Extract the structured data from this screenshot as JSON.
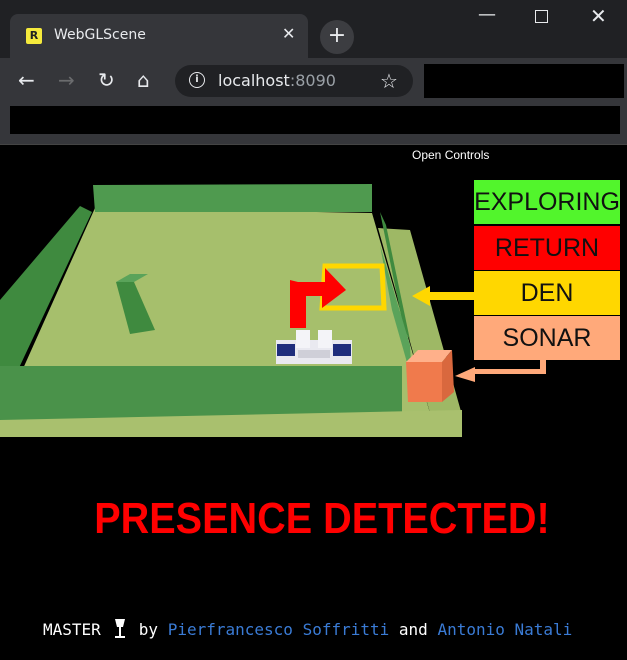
{
  "browser": {
    "tab_title": "WebGLScene",
    "favicon_letter": "R",
    "new_tab": "+",
    "url_host": "localhost",
    "url_port": ":8090"
  },
  "controls": {
    "open_label": "Open Controls"
  },
  "states": [
    {
      "label": "EXPLORING",
      "color": "#52f52c"
    },
    {
      "label": "RETURN",
      "color": "#ff0000"
    },
    {
      "label": "DEN",
      "color": "#ffd700"
    },
    {
      "label": "SONAR",
      "color": "#ffa97a"
    }
  ],
  "alert": "PRESENCE DETECTED!",
  "footer": {
    "prefix": "MASTER",
    "by": "by",
    "author1": "Pierfrancesco Soffritti",
    "and": "and",
    "author2": "Antonio Natali"
  }
}
